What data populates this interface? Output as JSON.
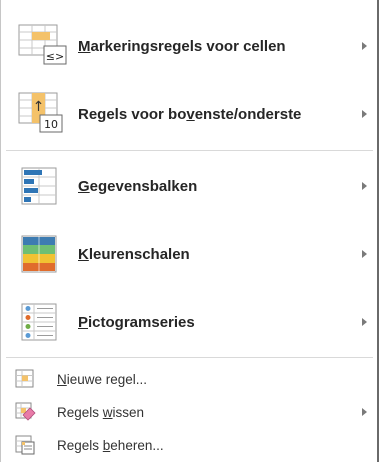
{
  "menu": {
    "items": [
      {
        "pre": "",
        "key": "M",
        "post": "arkeringsregels voor cellen",
        "has_submenu": true,
        "icon": "highlight-cells-icon"
      },
      {
        "pre": "Regels voor bo",
        "key": "v",
        "post": "enste/onderste",
        "has_submenu": true,
        "icon": "top-bottom-icon"
      },
      {
        "pre": "",
        "key": "G",
        "post": "egevensbalken",
        "has_submenu": true,
        "icon": "data-bars-icon"
      },
      {
        "pre": "",
        "key": "K",
        "post": "leurenschalen",
        "has_submenu": true,
        "icon": "color-scales-icon"
      },
      {
        "pre": "",
        "key": "P",
        "post": "ictogramseries",
        "has_submenu": true,
        "icon": "icon-sets-icon"
      }
    ],
    "commands": [
      {
        "pre": "",
        "key": "N",
        "post": "ieuwe regel...",
        "has_submenu": false,
        "icon": "new-rule-icon"
      },
      {
        "pre": "Regels ",
        "key": "w",
        "post": "issen",
        "has_submenu": true,
        "icon": "clear-rules-icon"
      },
      {
        "pre": "Regels ",
        "key": "b",
        "post": "eheren...",
        "has_submenu": false,
        "icon": "manage-rules-icon"
      }
    ],
    "icon_glyphs": {
      "less_equal": "≤>",
      "ten": "10",
      "up_arrow": "↑"
    },
    "colors": {
      "accent_yellow": "#f4c26a",
      "accent_blue": "#2e75b6",
      "arrow": "#7a7a7a"
    }
  }
}
